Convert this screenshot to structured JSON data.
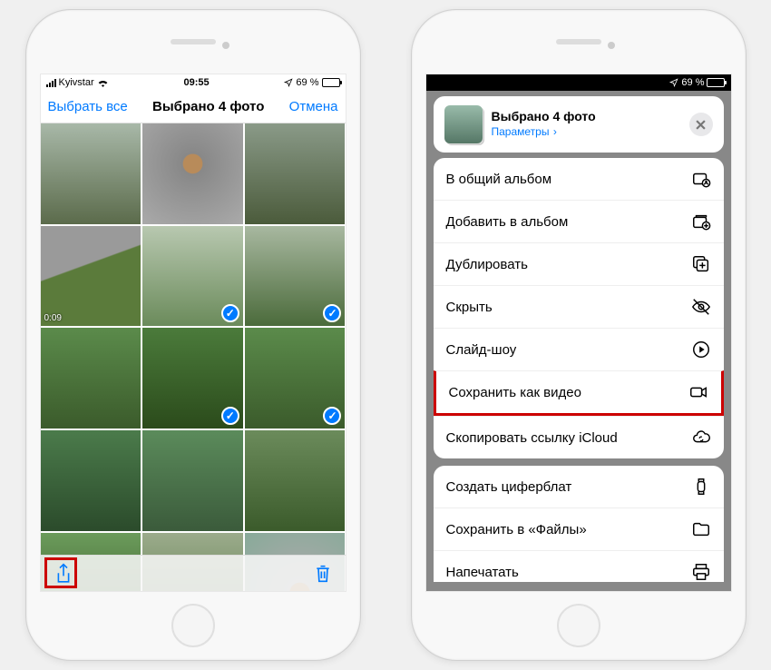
{
  "phone1": {
    "status": {
      "carrier": "Kyivstar",
      "time": "09:55",
      "battery_text": "69 %"
    },
    "nav": {
      "select_all": "Выбрать все",
      "title": "Выбрано 4 фото",
      "cancel": "Отмена"
    },
    "video_duration": "0:09",
    "selected_indices": [
      4,
      5,
      7,
      8
    ],
    "accent": "#007aff"
  },
  "phone2": {
    "status": {
      "battery_text": "69 %"
    },
    "sheet": {
      "title": "Выбрано 4 фото",
      "params": "Параметры",
      "chevron": "›"
    },
    "actions_group1": [
      {
        "label": "В общий альбом",
        "icon": "shared-album-icon"
      },
      {
        "label": "Добавить в альбом",
        "icon": "add-album-icon"
      },
      {
        "label": "Дублировать",
        "icon": "duplicate-icon"
      },
      {
        "label": "Скрыть",
        "icon": "hide-icon"
      },
      {
        "label": "Слайд-шоу",
        "icon": "play-icon"
      },
      {
        "label": "Сохранить как видео",
        "icon": "video-icon",
        "highlight": true
      },
      {
        "label": "Скопировать ссылку iCloud",
        "icon": "cloud-link-icon"
      }
    ],
    "actions_group2": [
      {
        "label": "Создать циферблат",
        "icon": "watch-icon"
      },
      {
        "label": "Сохранить в «Файлы»",
        "icon": "folder-icon"
      },
      {
        "label": "Напечатать",
        "icon": "print-icon"
      }
    ]
  }
}
